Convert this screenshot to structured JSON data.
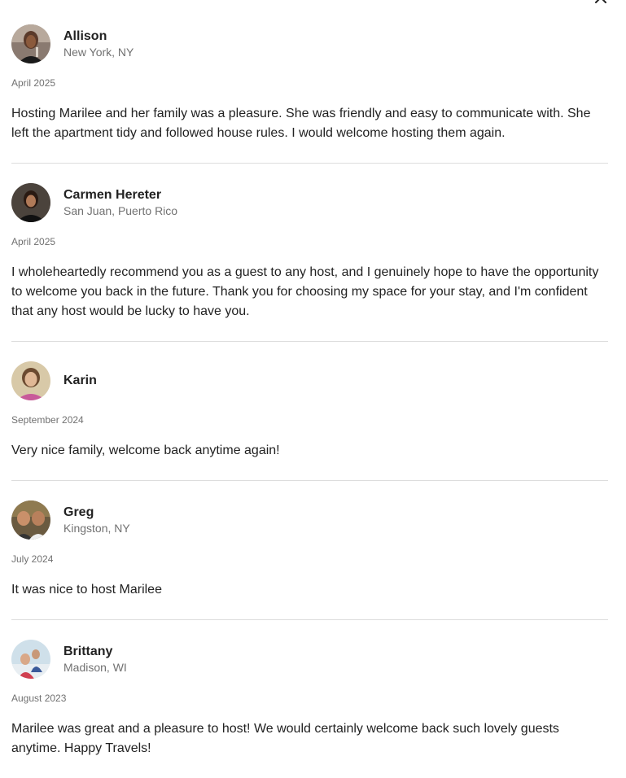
{
  "close": {
    "icon": "close-icon"
  },
  "reviews": [
    {
      "name": "Allison",
      "location": "New York, NY",
      "date": "April 2025",
      "text": "Hosting Marilee and her family was a pleasure. She was friendly and easy to communicate with. She left the apartment tidy and followed house rules. I would welcome hosting them again."
    },
    {
      "name": "Carmen Hereter",
      "location": "San Juan, Puerto Rico",
      "date": "April 2025",
      "text": "I wholeheartedly recommend you as a guest to any host, and I genuinely hope to have the opportunity to welcome you back in the future. Thank you for choosing my space for your stay, and I'm confident that any host would be lucky to have you."
    },
    {
      "name": "Karin",
      "location": "",
      "date": "September 2024",
      "text": "Very nice family, welcome back anytime again!"
    },
    {
      "name": "Greg",
      "location": "Kingston, NY",
      "date": "July 2024",
      "text": "It was nice to host Marilee"
    },
    {
      "name": "Brittany",
      "location": "Madison, WI",
      "date": "August 2023",
      "text": "Marilee was great and a pleasure to host! We would certainly welcome back such lovely guests anytime. Happy Travels!"
    }
  ]
}
